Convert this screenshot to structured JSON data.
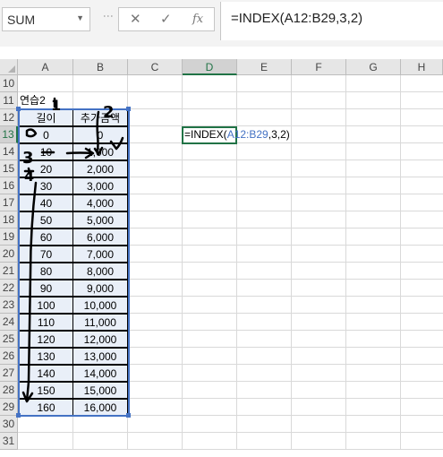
{
  "formula_bar": {
    "name_box": "SUM",
    "cancel_symbol": "✕",
    "enter_symbol": "✓",
    "fx_symbol": "fx",
    "formula": "=INDEX(A12:B29,3,2)"
  },
  "columns": [
    "A",
    "B",
    "C",
    "D",
    "E",
    "F",
    "G",
    "H"
  ],
  "rows": [
    "10",
    "11",
    "12",
    "13",
    "14",
    "15",
    "16",
    "17",
    "18",
    "19",
    "20",
    "21",
    "22",
    "23",
    "24",
    "25",
    "26",
    "27",
    "28",
    "29",
    "30",
    "31"
  ],
  "cells": {
    "title": "연습2",
    "header_length": "길이",
    "header_amount": "추가금액"
  },
  "table": [
    [
      "0",
      "0"
    ],
    [
      "10",
      "1,000"
    ],
    [
      "20",
      "2,000"
    ],
    [
      "30",
      "3,000"
    ],
    [
      "40",
      "4,000"
    ],
    [
      "50",
      "5,000"
    ],
    [
      "60",
      "6,000"
    ],
    [
      "70",
      "7,000"
    ],
    [
      "80",
      "8,000"
    ],
    [
      "90",
      "9,000"
    ],
    [
      "100",
      "10,000"
    ],
    [
      "110",
      "11,000"
    ],
    [
      "120",
      "12,000"
    ],
    [
      "130",
      "13,000"
    ],
    [
      "140",
      "14,000"
    ],
    [
      "150",
      "15,000"
    ],
    [
      "160",
      "16,000"
    ]
  ],
  "editing_cell": {
    "prefix": "=INDEX(",
    "ref": "A12:B29",
    "suffix": ",3,2)"
  },
  "annotations": {
    "ink_one": "1",
    "ink_two": "2",
    "ink_three": "3",
    "ink_four": "4"
  },
  "colors": {
    "accent_green": "#217346",
    "range_blue": "#4472c4",
    "table_fill": "#e9eff8"
  }
}
